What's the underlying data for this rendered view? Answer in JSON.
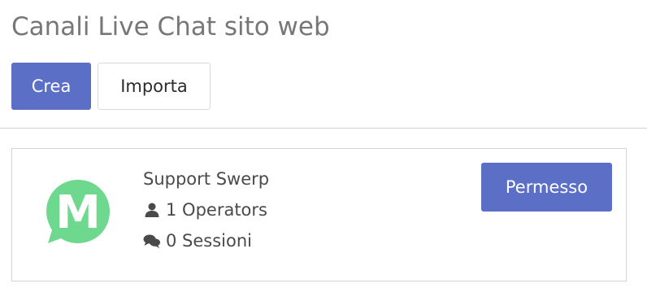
{
  "page": {
    "title": "Canali Live Chat sito web"
  },
  "toolbar": {
    "create_label": "Crea",
    "import_label": "Importa"
  },
  "channel": {
    "name": "Support Swerp",
    "operators": "1 Operators",
    "sessions": "0 Sessioni",
    "permission_label": "Permesso",
    "avatar_letter": "M",
    "avatar_color": "#6fd88f"
  },
  "colors": {
    "primary": "#5b6fc6",
    "title_text": "#777777",
    "body_text": "#4a4a4a"
  }
}
